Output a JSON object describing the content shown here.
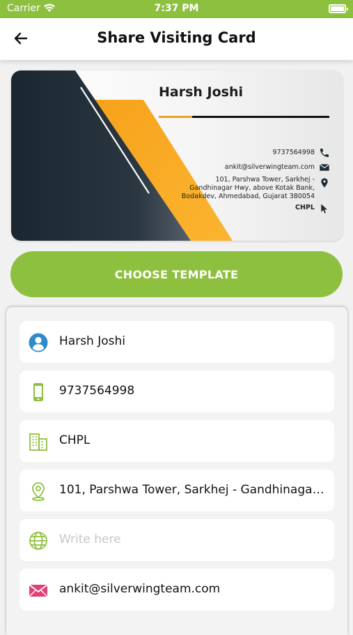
{
  "status_bar": {
    "carrier": "Carrier",
    "time": "7:37 PM"
  },
  "header": {
    "title": "Share Visiting Card"
  },
  "card": {
    "name": "Harsh Joshi",
    "phone": "9737564998",
    "email": "ankit@silverwingteam.com",
    "address_line1": "101, Parshwa Tower, Sarkhej -",
    "address_line2": "Gandhinagar Hwy, above Kotak Bank,",
    "address_line3": "Bodakdev, Ahmedabad, Gujarat 380054",
    "company": "CHPL"
  },
  "choose_template_label": "CHOOSE TEMPLATE",
  "form": {
    "fields": [
      {
        "icon": "user-icon",
        "value": "Harsh Joshi"
      },
      {
        "icon": "phone-icon",
        "value": "9737564998"
      },
      {
        "icon": "building-icon",
        "value": "CHPL"
      },
      {
        "icon": "location-icon",
        "value": "101, Parshwa Tower, Sarkhej - Gandhinagar Hwy, above Kotak Bank, Bodakdev, Ahmedabad, Gujarat 380054"
      },
      {
        "icon": "globe-icon",
        "value": "",
        "placeholder": "Write here"
      },
      {
        "icon": "mail-icon",
        "value": "ankit@silverwingteam.com"
      }
    ]
  },
  "colors": {
    "accent_green": "#8ec03f",
    "card_orange": "#f5a623",
    "card_dark": "#1d2a33",
    "icon_blue": "#2e8bc9",
    "icon_pink": "#e0407a"
  }
}
